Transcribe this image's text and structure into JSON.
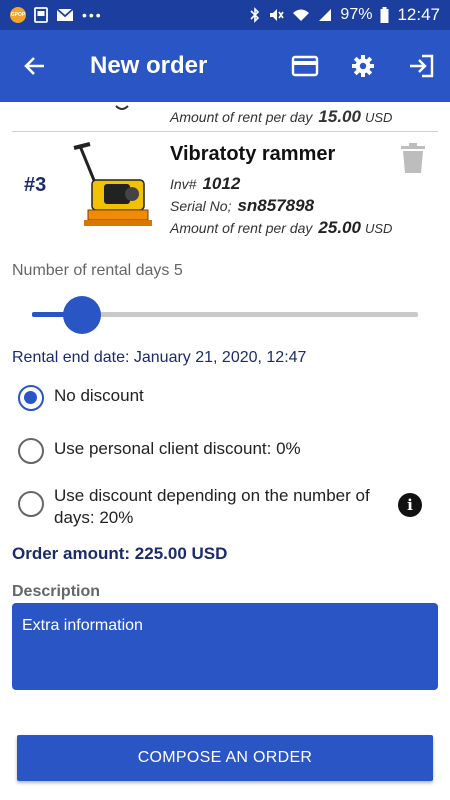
{
  "status_bar": {
    "badge": "GPOP",
    "battery": "97%",
    "time": "12:47",
    "icons": [
      "image-icon",
      "mail-icon",
      "more-icon",
      "bluetooth-icon",
      "mute-icon",
      "wifi-icon",
      "signal-icon",
      "battery-icon"
    ]
  },
  "app_bar": {
    "title": "New order",
    "icons": [
      "back-arrow-icon",
      "card-icon",
      "gear-icon",
      "exit-icon"
    ],
    "color": "#2a55c4"
  },
  "partial_item": {
    "amount_label": "Amount of rent per day",
    "amount_value": "15.00",
    "currency": "USD"
  },
  "item": {
    "number": "#3",
    "name": "Vibratoty rammer",
    "inv_label": "Inv#",
    "inv_value": "1012",
    "serial_label": "Serial No;",
    "serial_value": "sn857898",
    "amount_label": "Amount of rent per day",
    "amount_value": "25.00",
    "currency": "USD"
  },
  "rental": {
    "days_label": "Number of rental days 5",
    "slider_fraction": 0.13,
    "end_date": "Rental end date: January 21, 2020, 12:47"
  },
  "discounts": [
    {
      "label": "No discount",
      "checked": true
    },
    {
      "label": "Use personal client discount: 0%",
      "checked": false
    },
    {
      "label": "Use discount depending on the number of days: 20%",
      "checked": false
    }
  ],
  "order_amount": "Order amount: 225.00 USD",
  "description": {
    "label": "Description",
    "value": "Extra information"
  },
  "compose_button": "COMPOSE AN ORDER",
  "colors": {
    "primary": "#2a55c4",
    "status_bar": "#1c3f9f",
    "accent_text": "#1c2b6b"
  }
}
